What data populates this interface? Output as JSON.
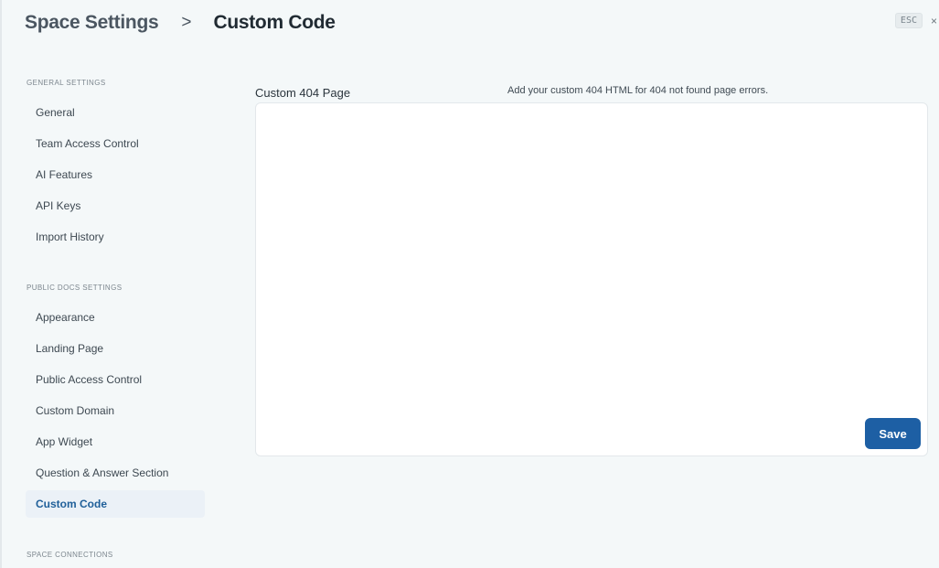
{
  "header": {
    "parent": "Space Settings",
    "separator": ">",
    "current": "Custom Code",
    "esc_label": "ESC",
    "close_glyph": "×"
  },
  "sidebar": {
    "general_title": "GENERAL SETTINGS",
    "general_items": [
      "General",
      "Team Access Control",
      "AI Features",
      "API Keys",
      "Import History"
    ],
    "public_title": "PUBLIC DOCS SETTINGS",
    "public_items": [
      "Appearance",
      "Landing Page",
      "Public Access Control",
      "Custom Domain",
      "App Widget",
      "Question & Answer Section",
      "Custom Code"
    ],
    "active_item": "Custom Code",
    "connections_title": "SPACE CONNECTIONS"
  },
  "main": {
    "field_label": "Custom 404 Page",
    "field_description": "Add your custom 404 HTML for 404 not found page errors.",
    "editor_value": "",
    "save_label": "Save"
  },
  "colors": {
    "background": "#f4f8f9",
    "accent": "#1d5fa4",
    "active_item_bg": "#ebf1f7"
  }
}
